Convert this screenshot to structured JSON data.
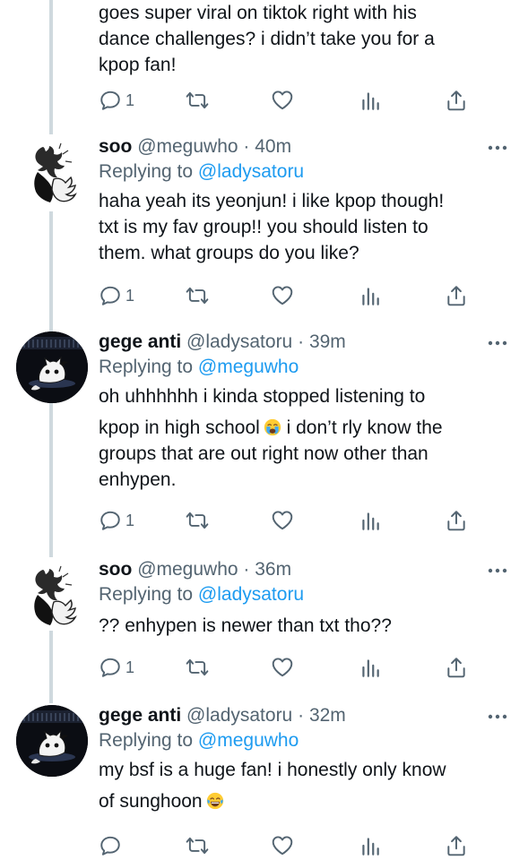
{
  "tweets": [
    {
      "id": "t0",
      "body_lines": [
        "goes super viral on tiktok right with his",
        "dance challenges? i didn’t take you for a",
        "kpop fan!"
      ],
      "reply_count": "1"
    },
    {
      "id": "t1",
      "name": "soo",
      "handle": "@meguwho",
      "dot": "·",
      "time": "40m",
      "replying_label": "Replying to",
      "replying_to": "@ladysatoru",
      "body_lines": [
        "haha yeah its yeonjun! i like kpop though!",
        "txt is my fav group!! you should listen to",
        "them. what groups do you like?"
      ],
      "reply_count": "1"
    },
    {
      "id": "t2",
      "name": "gege anti",
      "handle": "@ladysatoru",
      "dot": "·",
      "time": "39m",
      "replying_label": "Replying to",
      "replying_to": "@meguwho",
      "body_lines": [
        "oh uhhhhhh i kinda stopped listening to",
        "kpop in high school",
        " i don’t rly know the",
        "groups that are out right now other than",
        "enhypen."
      ],
      "reply_count": "1"
    },
    {
      "id": "t3",
      "name": "soo",
      "handle": "@meguwho",
      "dot": "·",
      "time": "36m",
      "replying_label": "Replying to",
      "replying_to": "@ladysatoru",
      "body_lines": [
        "?? enhypen is newer than txt tho??"
      ],
      "reply_count": "1"
    },
    {
      "id": "t4",
      "name": "gege anti",
      "handle": "@ladysatoru",
      "dot": "·",
      "time": "32m",
      "replying_label": "Replying to",
      "replying_to": "@meguwho",
      "body_lines": [
        "my bsf is a huge fan! i honestly only know",
        "of sunghoon"
      ],
      "reply_count": ""
    }
  ],
  "icons": {
    "reply": "reply-icon",
    "retweet": "retweet-icon",
    "like": "heart-icon",
    "views": "views-icon",
    "share": "share-icon",
    "more": "more-icon",
    "crying_emoji": "loudly-crying-face-icon",
    "laughing_emoji": "tears-of-joy-face-icon"
  },
  "colors": {
    "text": "#0f1419",
    "secondary": "#536471",
    "link": "#1d9bf0",
    "thread_line": "#cfd9de"
  }
}
